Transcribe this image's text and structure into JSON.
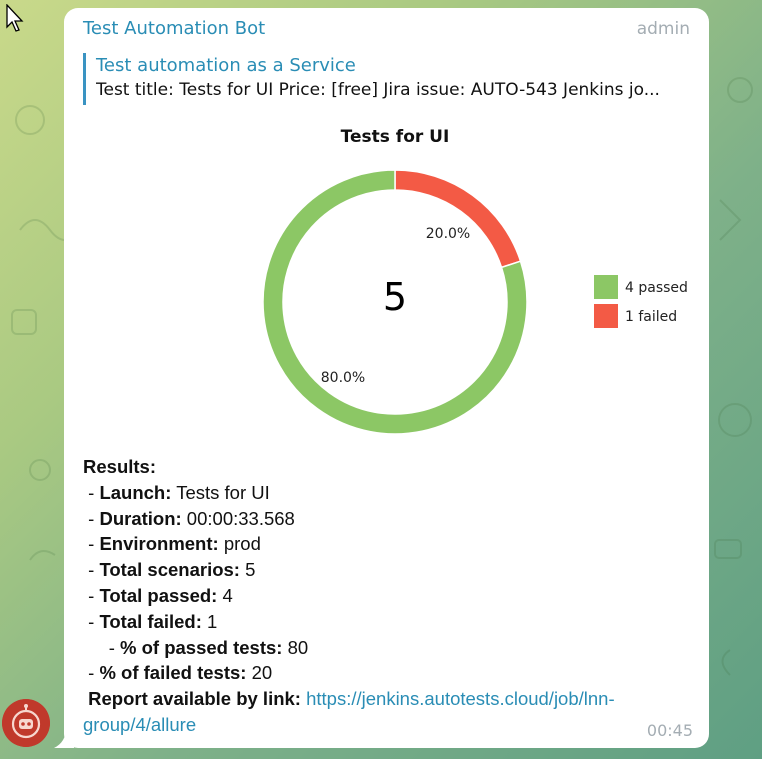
{
  "message": {
    "sender": "Test Automation Bot",
    "role": "admin",
    "time": "00:45",
    "reply": {
      "title": "Test automation as a Service",
      "text": "Test title: Tests for UI Price: [free] Jira issue: AUTO-543 Jenkins jo..."
    },
    "results": {
      "heading": "Results:",
      "launch_label": "Launch:",
      "launch_value": " Tests for UI",
      "duration_label": "Duration:",
      "duration_value": " 00:00:33.568",
      "environment_label": "Environment:",
      "environment_value": " prod",
      "scenarios_label": "Total scenarios:",
      "scenarios_value": " 5",
      "passed_label": "Total passed:",
      "passed_value": " 4",
      "failed_label": "Total failed:",
      "failed_value": " 1",
      "pct_passed_label": "% of passed tests:",
      "pct_passed_value": " 80",
      "pct_failed_label": "% of failed tests:",
      "pct_failed_value": " 20",
      "report_label": "Report available by link:",
      "report_link_line1": "https://jenkins.autotests.cloud/job/lnn-",
      "report_link_line2": "group/4/allure"
    }
  },
  "chart_data": {
    "type": "pie",
    "title": "Tests for UI",
    "center_label": "5",
    "slices": [
      {
        "label": "4 passed",
        "value": 4,
        "percent_label": "80.0%",
        "color": "#8cc765"
      },
      {
        "label": "1 failed",
        "value": 1,
        "percent_label": "20.0%",
        "color": "#f35a45"
      }
    ],
    "legend_position": "right"
  },
  "colors": {
    "accent": "#2a8db5",
    "muted": "#a4adb3"
  }
}
